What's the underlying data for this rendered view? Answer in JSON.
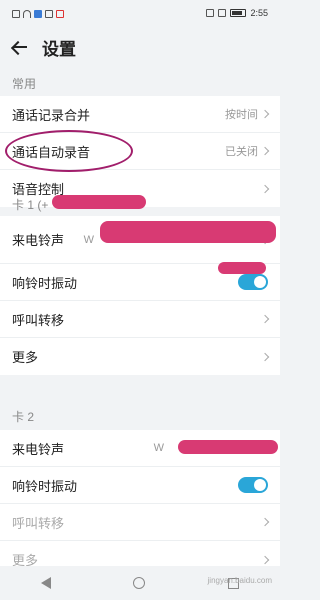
{
  "status": {
    "time": "2:55"
  },
  "header": {
    "title": "设置"
  },
  "sections": {
    "common": {
      "label": "常用",
      "rows": [
        {
          "label": "通话记录合并",
          "value": "按时间"
        },
        {
          "label": "通话自动录音",
          "value": "已关闭"
        },
        {
          "label": "语音控制",
          "value": ""
        }
      ]
    },
    "card1": {
      "label": "卡 1 (+",
      "rows": [
        {
          "label": "来电铃声",
          "value": "W"
        },
        {
          "label": "响铃时振动",
          "toggle": "on"
        },
        {
          "label": "呼叫转移"
        },
        {
          "label": "更多"
        }
      ]
    },
    "card2": {
      "label": "卡 2",
      "rows": [
        {
          "label": "来电铃声",
          "value": "W"
        },
        {
          "label": "响铃时振动",
          "toggle": "on"
        },
        {
          "label": "呼叫转移"
        },
        {
          "label": "更多"
        }
      ]
    }
  },
  "watermark": "jingyan.baidu.com"
}
